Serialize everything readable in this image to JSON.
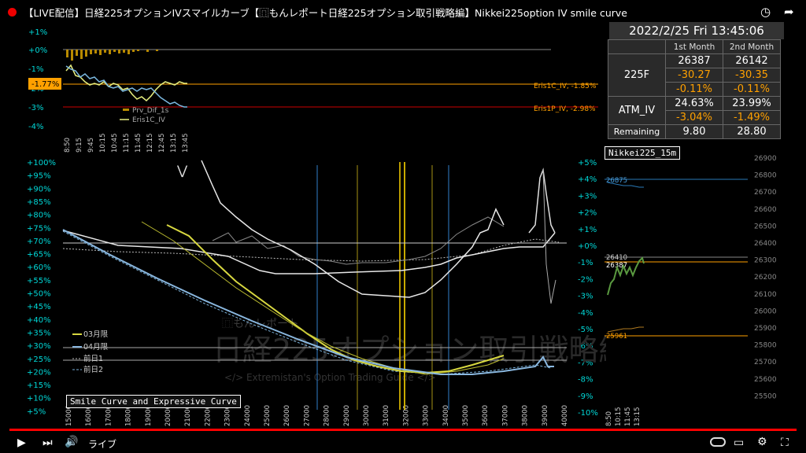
{
  "window": {
    "title": "【LIVE配信】日経225オプションIVスマイルカーブ【⿵もんレポート日経225オプション取引戦略編】Nikkei225option IV smile curve",
    "overlay_title": "Option IV Smile Cu",
    "datetime": "2022/2/25 Fri 13:45:06"
  },
  "colors": {
    "accent_orange": "#ffa000",
    "cyan": "#00e0e0",
    "live_red": "#ff0000"
  },
  "summary_table": {
    "headers": [
      "1st Month",
      "2nd Month"
    ],
    "f225_label": "225F",
    "f225_rows": [
      [
        "26387",
        "26142"
      ],
      [
        "-30.27",
        "-30.35"
      ],
      [
        "-0.11%",
        "-0.11%"
      ]
    ],
    "atm_label": "ATM_IV",
    "atm_rows": [
      [
        "24.63%",
        "23.99%"
      ],
      [
        "-3.04%",
        "-1.49%"
      ]
    ],
    "remaining_label": "Remaining",
    "remaining": [
      "9.80",
      "28.80"
    ]
  },
  "top_chart": {
    "y_ticks": [
      "+1%",
      "+0%",
      "-1%",
      "-2%",
      "-3%",
      "-4%"
    ],
    "current_badge": "-1.77%",
    "x_ticks": [
      "8:50",
      "9:15",
      "9:45",
      "10:15",
      "10:45",
      "11:15",
      "11:45",
      "12:15",
      "12:45",
      "13:15",
      "13:45"
    ],
    "legend": [
      "Prv_Dif_1s",
      "Eris1C_IV"
    ],
    "right_labels": [
      "Eris1C_IV, -1.85%",
      "Eris1P_IV, -2.98%"
    ]
  },
  "main_chart": {
    "left_ticks": [
      "+100%",
      "+95%",
      "+90%",
      "+85%",
      "+80%",
      "+75%",
      "+70%",
      "+65%",
      "+60%",
      "+55%",
      "+50%",
      "+45%",
      "+40%",
      "+35%",
      "+30%",
      "+25%",
      "+20%",
      "+15%",
      "+10%",
      "+5%"
    ],
    "right_ticks": [
      "+5%",
      "+4%",
      "+3%",
      "+2%",
      "+1%",
      "+0%",
      "-1%",
      "-2%",
      "-3%",
      "-4%",
      "-5%",
      "-6%",
      "-7%",
      "-8%",
      "-9%",
      "-10%"
    ],
    "x_ticks": [
      "15000",
      "16000",
      "17000",
      "18000",
      "19000",
      "20000",
      "21000",
      "22000",
      "23000",
      "24000",
      "25000",
      "26000",
      "27000",
      "28000",
      "29000",
      "30000",
      "31000",
      "32000",
      "33000",
      "34000",
      "35000",
      "36000",
      "37000",
      "38000",
      "39000",
      "40000"
    ],
    "legend": [
      "03月限",
      "04月限",
      "前日1",
      "前日2"
    ],
    "watermark_1": "⿵もんレポート",
    "watermark_2": "日経225オプション取引戦略編",
    "watermark_3": "</> Extremistan's Option Trading Guide </>",
    "footer_label": "Smile Curve and Expressive Curve"
  },
  "nikkei_chart": {
    "label": "Nikkei225_15m",
    "y_ticks": [
      "26900",
      "26800",
      "26700",
      "26600",
      "26500",
      "26400",
      "26300",
      "26200",
      "26100",
      "26000",
      "25900",
      "25800",
      "25700",
      "25600",
      "25500"
    ],
    "x_ticks": [
      "8:50",
      "10:15",
      "11:45",
      "13:15"
    ],
    "levels": [
      "26875",
      "26410",
      "26387",
      "25961"
    ]
  },
  "player": {
    "live_label": "ライブ"
  }
}
